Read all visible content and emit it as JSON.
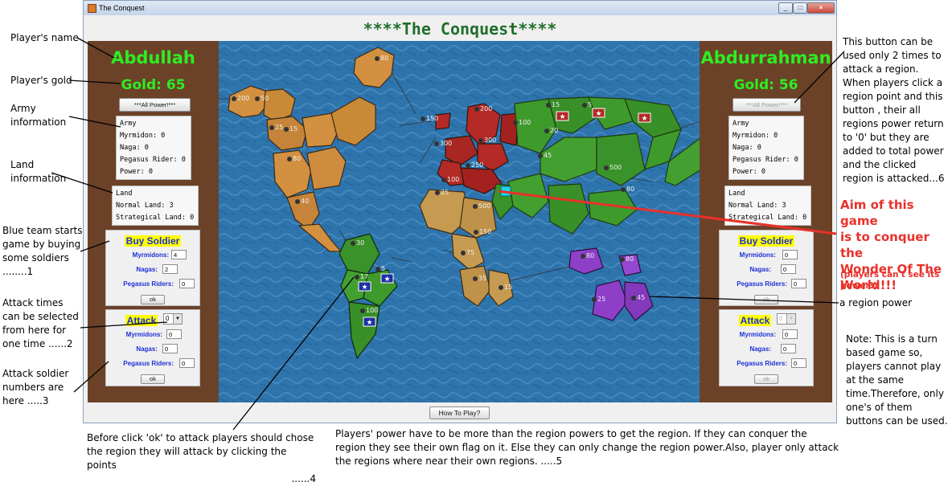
{
  "window": {
    "title": "The Conquest",
    "game_title": "****The Conquest****",
    "how_to_play": "How To Play?"
  },
  "players": [
    {
      "name": "Abdullah",
      "gold": "Gold: 65",
      "all_power": "***All Power!***",
      "army": {
        "title": "Army",
        "myrmidon": "Myrmidon: 0",
        "naga": "Naga: 0",
        "pegasus": "Pegasus Rider: 0",
        "power": "Power: 0"
      },
      "land": {
        "title": "Land",
        "normal": "Normal Land: 3",
        "strategical": "Strategical Land: 0"
      },
      "buy": {
        "title": "Buy Soldier",
        "myrmidons_label": "Myrmidons:",
        "myrmidons_value": "4",
        "nagas_label": "Nagas:",
        "nagas_value": "2",
        "pegasus_label": "Pegasus Riders:",
        "pegasus_value": "0",
        "ok": "ok"
      },
      "attack": {
        "title": "Attack",
        "times": "0",
        "myrmidons_label": "Myrmidons:",
        "myrmidons_value": "0",
        "nagas_label": "Nagas:",
        "nagas_value": "0",
        "pegasus_label": "Pegasus Riders:",
        "pegasus_value": "0",
        "ok": "ok"
      }
    },
    {
      "name": "Abdurrahman",
      "gold": "Gold: 56",
      "all_power": "***All Power!***",
      "army": {
        "title": "Army",
        "myrmidon": "Myrmidon: 0",
        "naga": "Naga: 0",
        "pegasus": "Pegasus Rider: 0",
        "power": "Power: 0"
      },
      "land": {
        "title": "Land",
        "normal": "Normal Land: 3",
        "strategical": "Strategical Land: 0"
      },
      "buy": {
        "title": "Buy Soldier",
        "myrmidons_label": "Myrmidons:",
        "myrmidons_value": "0",
        "nagas_label": "Nagas:",
        "nagas_value": "0",
        "pegasus_label": "Pegasus Riders:",
        "pegasus_value": "0",
        "ok": "ok"
      },
      "attack": {
        "title": "Attack",
        "times": "0",
        "myrmidons_label": "Myrmidons:",
        "myrmidons_value": "0",
        "nagas_label": "Nagas:",
        "nagas_value": "0",
        "pegasus_label": "Pegasus Riders:",
        "pegasus_value": "0",
        "ok": "ok"
      }
    }
  ],
  "annotations": {
    "player_name": "Player's name",
    "player_gold": "Player's gold",
    "army_info": [
      "Army",
      "information"
    ],
    "land_info": [
      "Land",
      "information"
    ],
    "blue_starts": [
      "Blue team starts",
      "game by buying",
      "some soldiers",
      "........1"
    ],
    "attack_times": [
      "Attack times",
      "can be selected",
      "from here for",
      "one time ......2"
    ],
    "attack_numbers": [
      "Attack soldier",
      "numbers are",
      "here .....3"
    ],
    "before_ok": [
      "Before click 'ok' to attack players should chose",
      "the region they will attack by clicking the points",
      "......4"
    ],
    "power_rule": [
      "Players' power have to be more than the region powers to get the region. If they can conquer the",
      "region they see their own flag on it. Else they can only change the region power.Also, player only attack",
      "the regions where near their own regions. .....5"
    ],
    "all_power_note": [
      "This button can be",
      "used only 2 times to",
      "attack a region.",
      "When players click a",
      "region point and this",
      "button , their all",
      "regions power return",
      "to '0' but they are",
      "added to total power",
      "and the clicked",
      "region is attacked...6"
    ],
    "aim": [
      "Aim of this game",
      "is to conquer the",
      "Wonder Of The",
      "World!!!"
    ],
    "aim_note": [
      "(players can't see its",
      "power!)"
    ],
    "region_power": "a region power",
    "turn_note": [
      "Note: This is a turn",
      "based game so,",
      "players cannot play",
      "at the same",
      "time.Therefore, only",
      "one's of them",
      "buttons can be used."
    ]
  },
  "map": {
    "region_powers": [
      "80",
      "200",
      "50",
      "25",
      "15",
      "80",
      "40",
      "150",
      "200",
      "300",
      "100",
      "300",
      "250",
      "100",
      "15",
      "5",
      "45",
      "20",
      "500",
      "80",
      "5",
      "25",
      "45",
      "500",
      "150",
      "75",
      "35",
      "15",
      "30",
      "17",
      "5",
      "100",
      "80",
      "80",
      "25",
      "45"
    ],
    "colors": {
      "sea": "#2c6fa6",
      "americas_north": "#d4913a",
      "europe": "#b32a26",
      "asia": "#3f9a2c",
      "africa": "#c79a52",
      "australia": "#8e3fc8"
    },
    "flag_icon": "star-flag-icon",
    "wonder_icon": "wonder-marker-icon"
  }
}
